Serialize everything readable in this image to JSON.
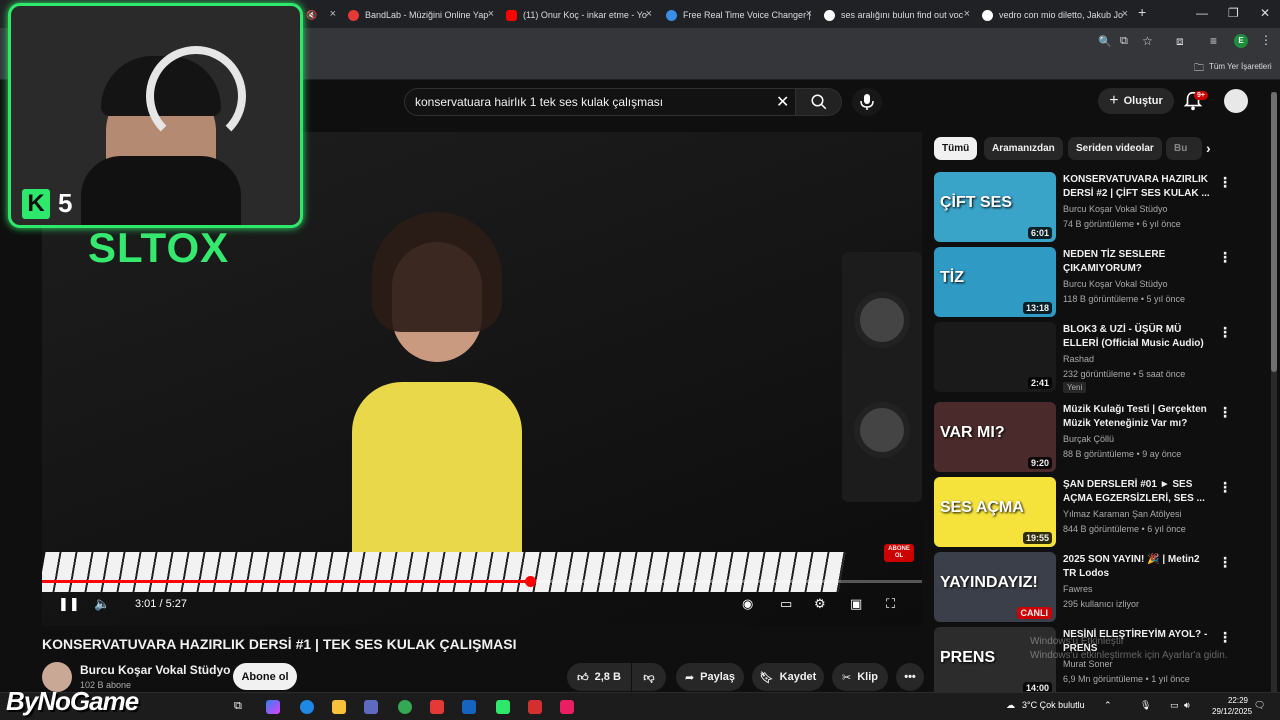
{
  "browser": {
    "tabs": [
      {
        "label": "BandLab - Müziğini Online Yap",
        "color": "#e53935"
      },
      {
        "label": "(11) Onur Koç - inkar etme - Yo",
        "color": "#ff0000"
      },
      {
        "label": "Free Real Time Voice Changer |",
        "color": "#3a8ee6"
      },
      {
        "label": "ses aralığını bulun find out voc",
        "color": "#5f6368"
      },
      {
        "label": "vedro con mio diletto, Jakub Jo",
        "color": "#5f6368"
      }
    ],
    "bookmarks_label": "Tüm Yer İşaretleri",
    "profile_letter": "E"
  },
  "youtube": {
    "search": {
      "value": "konservatuara hairlık 1 tek ses kulak çalışması"
    },
    "create_label": "Oluştur",
    "notif_badge": "9+",
    "player": {
      "time": "3:01 / 5:27",
      "progress": 0.554,
      "abone_badge": "ABONE OL"
    },
    "video_title": "KONSERVATUVARA HAZIRLIK DERSİ #1 | TEK SES KULAK ÇALIŞMASI",
    "channel": {
      "name": "Burcu Koşar Vokal Stüdyo",
      "subs": "102 B abone",
      "subscribe_label": "Abone ol"
    },
    "actions": {
      "likes": "2,8 B",
      "share": "Paylaş",
      "save": "Kaydet",
      "clip": "Klip"
    },
    "chips": [
      "Tümü",
      "Aramanızdan",
      "Seriden videolar",
      "Bu"
    ],
    "recommendations": [
      {
        "title": "KONSERVATUVARA HAZIRLIK DERSİ #2 | ÇİFT SES KULAK ...",
        "channel": "Burcu Koşar Vokal Stüdyo",
        "meta": "74 B görüntüleme • 6 yıl önce",
        "duration": "6:01",
        "thumb_text": "ÇİFT SES",
        "thumb_bg": "#3aa3c8"
      },
      {
        "title": "NEDEN TİZ SESLERE ÇIKAMIYORUM?",
        "channel": "Burcu Koşar Vokal Stüdyo",
        "meta": "118 B görüntüleme • 5 yıl önce",
        "duration": "13:18",
        "thumb_text": "TİZ",
        "thumb_bg": "#2f9ac4"
      },
      {
        "title": "BLOK3 & UZİ - ÜŞÜR MÜ ELLERİ (Official Music Audio) Ft. ...",
        "channel": "Rashad",
        "meta": "232 görüntüleme • 5 saat önce",
        "duration": "2:41",
        "tag": "Yeni",
        "thumb_text": "",
        "thumb_bg": "#1a1a1a"
      },
      {
        "title": "Müzik Kulağı Testi | Gerçekten Müzik Yeteneğiniz Var mı?",
        "channel": "Burçak Çöllü",
        "meta": "88 B görüntüleme • 9 ay önce",
        "duration": "9:20",
        "thumb_text": "VAR MI?",
        "thumb_bg": "#4a2a2a"
      },
      {
        "title": "ŞAN DERSLERİ #01 ► SES AÇMA EGZERSİZLERİ, SES ...",
        "channel": "Yılmaz Karaman Şan Atölyesi",
        "meta": "844 B görüntüleme • 6 yıl önce",
        "duration": "19:55",
        "thumb_text": "SES AÇMA",
        "thumb_bg": "#f5e23a"
      },
      {
        "title": "2025 SON YAYIN! 🎉 | Metin2 TR Lodos",
        "channel": "Fawres",
        "meta": "295 kullanıcı izliyor",
        "live": "CANLI",
        "thumb_text": "YAYINDAYIZ!",
        "thumb_bg": "#3b3f4a"
      },
      {
        "title": "NESİNİ ELEŞTİREYİM AYOL? - PRENS",
        "channel": "Murat Soner",
        "meta": "6,9 Mn görüntüleme • 1 yıl önce",
        "duration": "14:00",
        "thumb_text": "PRENS",
        "thumb_bg": "#2c2c2c"
      }
    ]
  },
  "overlay": {
    "streamer": "SLTOX",
    "level": "5",
    "k_letter": "K",
    "sponsor": "ByNoGame"
  },
  "watermark": {
    "line1": "Windows'u Etkinleştir",
    "line2": "Windows'u etkinleştirmek için Ayarlar'a gidin."
  },
  "taskbar": {
    "weather": "3°C  Çok bulutlu",
    "time": "22:29",
    "date": "29/12/2025"
  }
}
